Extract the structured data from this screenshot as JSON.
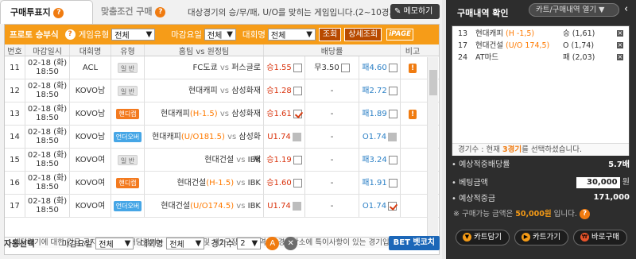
{
  "tabs": [
    {
      "label": "구매투표지"
    },
    {
      "label": "맞춤조건 구매"
    }
  ],
  "notice": "대상경기의 승/무/패, U/O를 맞히는 게임입니다.(2~10경기)",
  "memo_label": "메모하기",
  "filter": {
    "title": "프로토 승부식",
    "game_type_label": "게임유형",
    "game_type_value": "전체",
    "deadline_label": "마감요일",
    "deadline_value": "전체",
    "league_label": "대회명",
    "league_value": "전체",
    "search_label": "조회",
    "detail_label": "상세조회",
    "ipage_label": "iPAGE"
  },
  "headers": [
    "번호",
    "마감일시",
    "대회명",
    "유형",
    "홈팀 vs 원정팀",
    "배당률",
    "비고"
  ],
  "rows": [
    {
      "no": "11",
      "date": "02-18 (화)",
      "time": "18:50",
      "league": "ACL",
      "type": "일 반",
      "type_style": "gray",
      "home": "FC도쿄",
      "handicap": "",
      "away": "퍼스글로",
      "o1": "승1.55",
      "o2": "무3.50",
      "o3": "패4.60",
      "c1": "off",
      "c2": "off",
      "c3": "off",
      "note": "!"
    },
    {
      "no": "12",
      "date": "02-18 (화)",
      "time": "18:50",
      "league": "KOVO남",
      "type": "일 반",
      "type_style": "gray",
      "home": "현대캐피",
      "handicap": "",
      "away": "삼성화재",
      "o1": "승1.28",
      "o2": "-",
      "o3": "패2.72",
      "c1": "off",
      "c2": "",
      "c3": "off",
      "note": ""
    },
    {
      "no": "13",
      "date": "02-18 (화)",
      "time": "18:50",
      "league": "KOVO남",
      "type": "핸디캡",
      "type_style": "orange",
      "home": "현대캐피",
      "handicap": "(H-1.5)",
      "away": "삼성화재",
      "o1": "승1.61",
      "o2": "-",
      "o3": "패1.89",
      "c1": "on",
      "c2": "",
      "c3": "off",
      "note": "!"
    },
    {
      "no": "14",
      "date": "02-18 (화)",
      "time": "18:50",
      "league": "KOVO남",
      "type": "언더오버",
      "type_style": "blue",
      "home": "현대캐피",
      "handicap": "(U/O181.5)",
      "away": "삼성화재",
      "o1": "U1.74",
      "o2": "-",
      "o3": "O1.74",
      "c1": "dis",
      "c2": "",
      "c3": "dis",
      "note": ""
    },
    {
      "no": "15",
      "date": "02-18 (화)",
      "time": "18:50",
      "league": "KOVO여",
      "type": "일 반",
      "type_style": "gray",
      "home": "현대건설",
      "handicap": "",
      "away": "IBK",
      "o1": "승1.19",
      "o2": "-",
      "o3": "패3.24",
      "c1": "off",
      "c2": "",
      "c3": "off",
      "note": ""
    },
    {
      "no": "16",
      "date": "02-18 (화)",
      "time": "18:50",
      "league": "KOVO여",
      "type": "핸디캡",
      "type_style": "orange",
      "home": "현대건설",
      "handicap": "(H-1.5)",
      "away": "IBK",
      "o1": "승1.60",
      "o2": "-",
      "o3": "패1.91",
      "c1": "off",
      "c2": "",
      "c3": "off",
      "note": ""
    },
    {
      "no": "17",
      "date": "02-18 (화)",
      "time": "18:50",
      "league": "KOVO여",
      "type": "언더오버",
      "type_style": "blue",
      "home": "현대건설",
      "handicap": "(U/O174.5)",
      "away": "IBK",
      "o1": "U1.74",
      "o2": "-",
      "o3": "O1.74",
      "c1": "dis",
      "c2": "",
      "c3": "on",
      "note": ""
    }
  ],
  "footer_note": "! 해당경기에 대한 긴급 공지입니다.  * 해당경기는 중립경기장 및 제2구장, 타 지역 등 경기장소에 특이사항이 있는 경기입니다.",
  "bottom": {
    "auto_label": "자동선택",
    "deadline_label": "마감요일",
    "deadline_value": "전체",
    "league_label": "대회명",
    "league_value": "전체",
    "count_label": "경기수",
    "count_value": "2",
    "a_label": "A",
    "x_label": "✕",
    "betcoach_label": "BET 벳코치"
  },
  "right": {
    "title": "구매내역 확인",
    "cart_select": "카트/구매내역 열기",
    "items": [
      {
        "no": "13",
        "team": "현대캐피",
        "hc": "(H -1,5)",
        "pick": "승 (1,61)"
      },
      {
        "no": "17",
        "team": "현대건설",
        "hc": "(U/O 174,5)",
        "pick": "O (1,74)"
      },
      {
        "no": "24",
        "team": "AT마드",
        "hc": "",
        "pick": "패 (2,03)"
      }
    ],
    "count_text_pre": "경기수 : 현재",
    "count_num": "3경기",
    "count_text_post": "를 선택하셨습니다.",
    "odds_label": "예상적중배당률",
    "odds_value": "5.7배",
    "bet_label": "베팅금액",
    "bet_value": "30,000",
    "bet_unit": "원",
    "win_label": "예상적중금",
    "win_value": "171,000",
    "warn_pre": "※ 구매가능 금액은",
    "warn_amt": "50,000원",
    "warn_post": "입니다.",
    "btn_cart": "카트담기",
    "btn_cart_view": "카트가기",
    "btn_buy": "바로구매"
  },
  "colors": {
    "accent": "#f69c18",
    "dark": "#2d2d2d",
    "blue": "#1c67b8"
  }
}
